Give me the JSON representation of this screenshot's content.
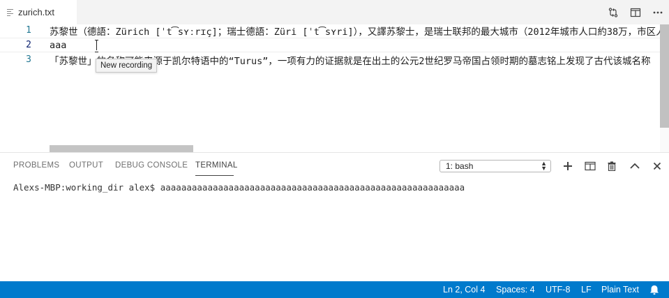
{
  "tab": {
    "label": "zurich.txt",
    "icon": "text-file-icon"
  },
  "tab_actions": [
    {
      "name": "open-changes-icon"
    },
    {
      "name": "split-editor-icon"
    },
    {
      "name": "more-actions-icon"
    }
  ],
  "editor": {
    "lines": [
      {
        "number": "1",
        "text": "苏黎世（德語：Zürich [ˈt͡sʏːrɪç]；瑞士德語：Züri [ˈt͡sʏri]），又譯苏黎士，是瑞士联邦的最大城市（2012年城市人口約38万，市区人口"
      },
      {
        "number": "2",
        "text": "aaa"
      },
      {
        "number": "3",
        "text": "「苏黎世」的名称可能来源于凯尔特语中的“Turus”，一项有力的证据就是在出土的公元2世纪罗马帝国占领时期的墓志铭上发现了古代该城名称"
      }
    ],
    "tooltip": "New recording"
  },
  "panel": {
    "tabs": [
      "PROBLEMS",
      "OUTPUT",
      "DEBUG CONSOLE",
      "TERMINAL"
    ],
    "active_tab": "TERMINAL",
    "terminal_select": "1: bash",
    "terminal_output": "Alexs-MBP:working_dir alex$ aaaaaaaaaaaaaaaaaaaaaaaaaaaaaaaaaaaaaaaaaaaaaaaaaaaaaaaaaa"
  },
  "status": {
    "position": "Ln 2, Col 4",
    "spaces": "Spaces: 4",
    "encoding": "UTF-8",
    "eol": "LF",
    "language": "Plain Text"
  },
  "colors": {
    "status_bar": "#007acc",
    "line_number": "#237893",
    "active_line_number": "#0b216f"
  }
}
